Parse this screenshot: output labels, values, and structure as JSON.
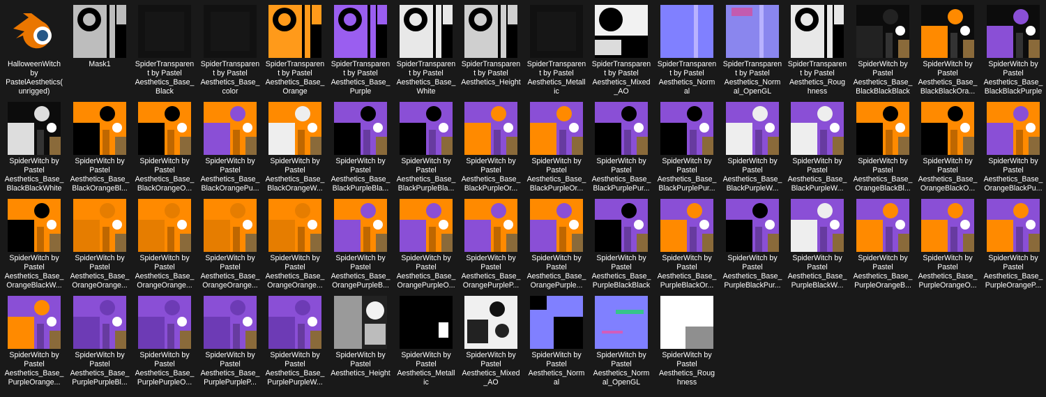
{
  "files": [
    {
      "name": "HalloweenWitch\nby\nPastelAesthetics(\nunrigged)",
      "thumb": "blender-icon"
    },
    {
      "name": "Mask1",
      "thumb": "mask"
    },
    {
      "name": "SpiderTransparen\nt by Pastel\nAesthetics_Base_\nBlack",
      "thumb": "dark"
    },
    {
      "name": "SpiderTransparen\nt by Pastel\nAesthetics_Base_\ncolor",
      "thumb": "dark"
    },
    {
      "name": "SpiderTransparen\nt by Pastel\nAesthetics_Base_\nOrange",
      "thumb": "orange-mask"
    },
    {
      "name": "SpiderTransparen\nt by Pastel\nAesthetics_Base_\nPurple",
      "thumb": "purple-mask"
    },
    {
      "name": "SpiderTransparen\nt by Pastel\nAesthetics_Base_\nWhite",
      "thumb": "white-mask"
    },
    {
      "name": "SpiderTransparen\nt by Pastel\nAesthetics_Height",
      "thumb": "grey-mask"
    },
    {
      "name": "SpiderTransparen\nt by Pastel\nAesthetics_Metall\nic",
      "thumb": "dark"
    },
    {
      "name": "SpiderTransparen\nt by Pastel\nAesthetics_Mixed\n_AO",
      "thumb": "ao"
    },
    {
      "name": "SpiderTransparen\nt by Pastel\nAesthetics_Norm\nal",
      "thumb": "normal"
    },
    {
      "name": "SpiderTransparen\nt by Pastel\nAesthetics_Norm\nal_OpenGL",
      "thumb": "normal-gl"
    },
    {
      "name": "SpiderTransparen\nt by Pastel\nAesthetics_Roug\nhness",
      "thumb": "white-mask"
    },
    {
      "name": "SpiderWitch by\nPastel\nAesthetics_Base_\nBlackBlackBlack",
      "thumb": "black-tex"
    },
    {
      "name": "SpiderWitch by\nPastel\nAesthetics_Base_\nBlackBlackOra...",
      "thumb": "black-orange"
    },
    {
      "name": "SpiderWitch by\nPastel\nAesthetics_Base_\nBlackBlackPurple",
      "thumb": "black-purple"
    },
    {
      "name": "SpiderWitch by\nPastel\nAesthetics_Base_\nBlackBlackWhite",
      "thumb": "black-white"
    },
    {
      "name": "SpiderWitch by\nPastel\nAesthetics_Base_\nBlackOrangeBl...",
      "thumb": "orange-black"
    },
    {
      "name": "SpiderWitch by\nPastel\nAesthetics_Base_\nBlackOrangeO...",
      "thumb": "orange-black"
    },
    {
      "name": "SpiderWitch by\nPastel\nAesthetics_Base_\nBlackOrangePu...",
      "thumb": "orange-purple"
    },
    {
      "name": "SpiderWitch by\nPastel\nAesthetics_Base_\nBlackOrangeW...",
      "thumb": "orange-white"
    },
    {
      "name": "SpiderWitch by\nPastel\nAesthetics_Base_\nBlackPurpleBla...",
      "thumb": "purple-black"
    },
    {
      "name": "SpiderWitch by\nPastel\nAesthetics_Base_\nBlackPurpleBla...",
      "thumb": "purple-black"
    },
    {
      "name": "SpiderWitch by\nPastel\nAesthetics_Base_\nBlackPurpleOr...",
      "thumb": "purple-orange"
    },
    {
      "name": "SpiderWitch by\nPastel\nAesthetics_Base_\nBlackPurpleOr...",
      "thumb": "purple-orange"
    },
    {
      "name": "SpiderWitch by\nPastel\nAesthetics_Base_\nBlackPurplePur...",
      "thumb": "purple-black"
    },
    {
      "name": "SpiderWitch by\nPastel\nAesthetics_Base_\nBlackPurplePur...",
      "thumb": "purple-black"
    },
    {
      "name": "SpiderWitch by\nPastel\nAesthetics_Base_\nBlackPurpleW...",
      "thumb": "purple-white"
    },
    {
      "name": "SpiderWitch by\nPastel\nAesthetics_Base_\nBlackPurpleW...",
      "thumb": "purple-white"
    },
    {
      "name": "SpiderWitch by\nPastel\nAesthetics_Base_\nOrangeBlackBl...",
      "thumb": "orange-web"
    },
    {
      "name": "SpiderWitch by\nPastel\nAesthetics_Base_\nOrangeBlackO...",
      "thumb": "orange-web"
    },
    {
      "name": "SpiderWitch by\nPastel\nAesthetics_Base_\nOrangeBlackPu...",
      "thumb": "orange-web-purple"
    },
    {
      "name": "SpiderWitch by\nPastel\nAesthetics_Base_\nOrangeBlackW...",
      "thumb": "orange-web"
    },
    {
      "name": "SpiderWitch by\nPastel\nAesthetics_Base_\nOrangeOrange...",
      "thumb": "orange-orange"
    },
    {
      "name": "SpiderWitch by\nPastel\nAesthetics_Base_\nOrangeOrange...",
      "thumb": "orange-orange"
    },
    {
      "name": "SpiderWitch by\nPastel\nAesthetics_Base_\nOrangeOrange...",
      "thumb": "orange-orange"
    },
    {
      "name": "SpiderWitch by\nPastel\nAesthetics_Base_\nOrangeOrange...",
      "thumb": "orange-orange"
    },
    {
      "name": "SpiderWitch by\nPastel\nAesthetics_Base_\nOrangePurpleB...",
      "thumb": "orange-purple2"
    },
    {
      "name": "SpiderWitch by\nPastel\nAesthetics_Base_\nOrangePurpleO...",
      "thumb": "orange-purple2"
    },
    {
      "name": "SpiderWitch by\nPastel\nAesthetics_Base_\nOrangePurpleP...",
      "thumb": "orange-purple2"
    },
    {
      "name": "SpiderWitch by\nPastel\nAesthetics_Base_\nOrangePurple...",
      "thumb": "orange-purple2"
    },
    {
      "name": "SpiderWitch by\nPastel\nAesthetics_Base_\nPurpleBlackBlack",
      "thumb": "purple-black"
    },
    {
      "name": "SpiderWitch by\nPastel\nAesthetics_Base_\nPurpleBlackOr...",
      "thumb": "purple-orange"
    },
    {
      "name": "SpiderWitch by\nPastel\nAesthetics_Base_\nPurpleBlackPur...",
      "thumb": "purple-black"
    },
    {
      "name": "SpiderWitch by\nPastel\nAesthetics_Base_\nPurpleBlackW...",
      "thumb": "purple-white"
    },
    {
      "name": "SpiderWitch by\nPastel\nAesthetics_Base_\nPurpleOrangeB...",
      "thumb": "purple-orange2"
    },
    {
      "name": "SpiderWitch by\nPastel\nAesthetics_Base_\nPurpleOrangeO...",
      "thumb": "purple-orange2"
    },
    {
      "name": "SpiderWitch by\nPastel\nAesthetics_Base_\nPurpleOrangeP...",
      "thumb": "purple-orange2"
    },
    {
      "name": "SpiderWitch by\nPastel\nAesthetics_Base_\nPurpleOrange...",
      "thumb": "purple-orange2"
    },
    {
      "name": "SpiderWitch by\nPastel\nAesthetics_Base_\nPurplePurpleBl...",
      "thumb": "purple-purple"
    },
    {
      "name": "SpiderWitch by\nPastel\nAesthetics_Base_\nPurplePurpleO...",
      "thumb": "purple-purple"
    },
    {
      "name": "SpiderWitch by\nPastel\nAesthetics_Base_\nPurplePurpleP...",
      "thumb": "purple-purple"
    },
    {
      "name": "SpiderWitch by\nPastel\nAesthetics_Base_\nPurplePurpleW...",
      "thumb": "purple-purple"
    },
    {
      "name": "SpiderWitch by\nPastel\nAesthetics_Height",
      "thumb": "height"
    },
    {
      "name": "SpiderWitch by\nPastel\nAesthetics_Metall\nic",
      "thumb": "metallic"
    },
    {
      "name": "SpiderWitch by\nPastel\nAesthetics_Mixed\n_AO",
      "thumb": "ao2"
    },
    {
      "name": "SpiderWitch by\nPastel\nAesthetics_Norm\nal",
      "thumb": "normal2"
    },
    {
      "name": "SpiderWitch by\nPastel\nAesthetics_Norm\nal_OpenGL",
      "thumb": "normal-gl2"
    },
    {
      "name": "SpiderWitch by\nPastel\nAesthetics_Roug\nhness",
      "thumb": "rough"
    }
  ],
  "colors": {
    "background": "#191919",
    "orange": "#ff8a00",
    "purple": "#8a4fd6",
    "normal_blue": "#8080ff",
    "blender_orange": "#ea7600",
    "blender_blue": "#265787"
  }
}
